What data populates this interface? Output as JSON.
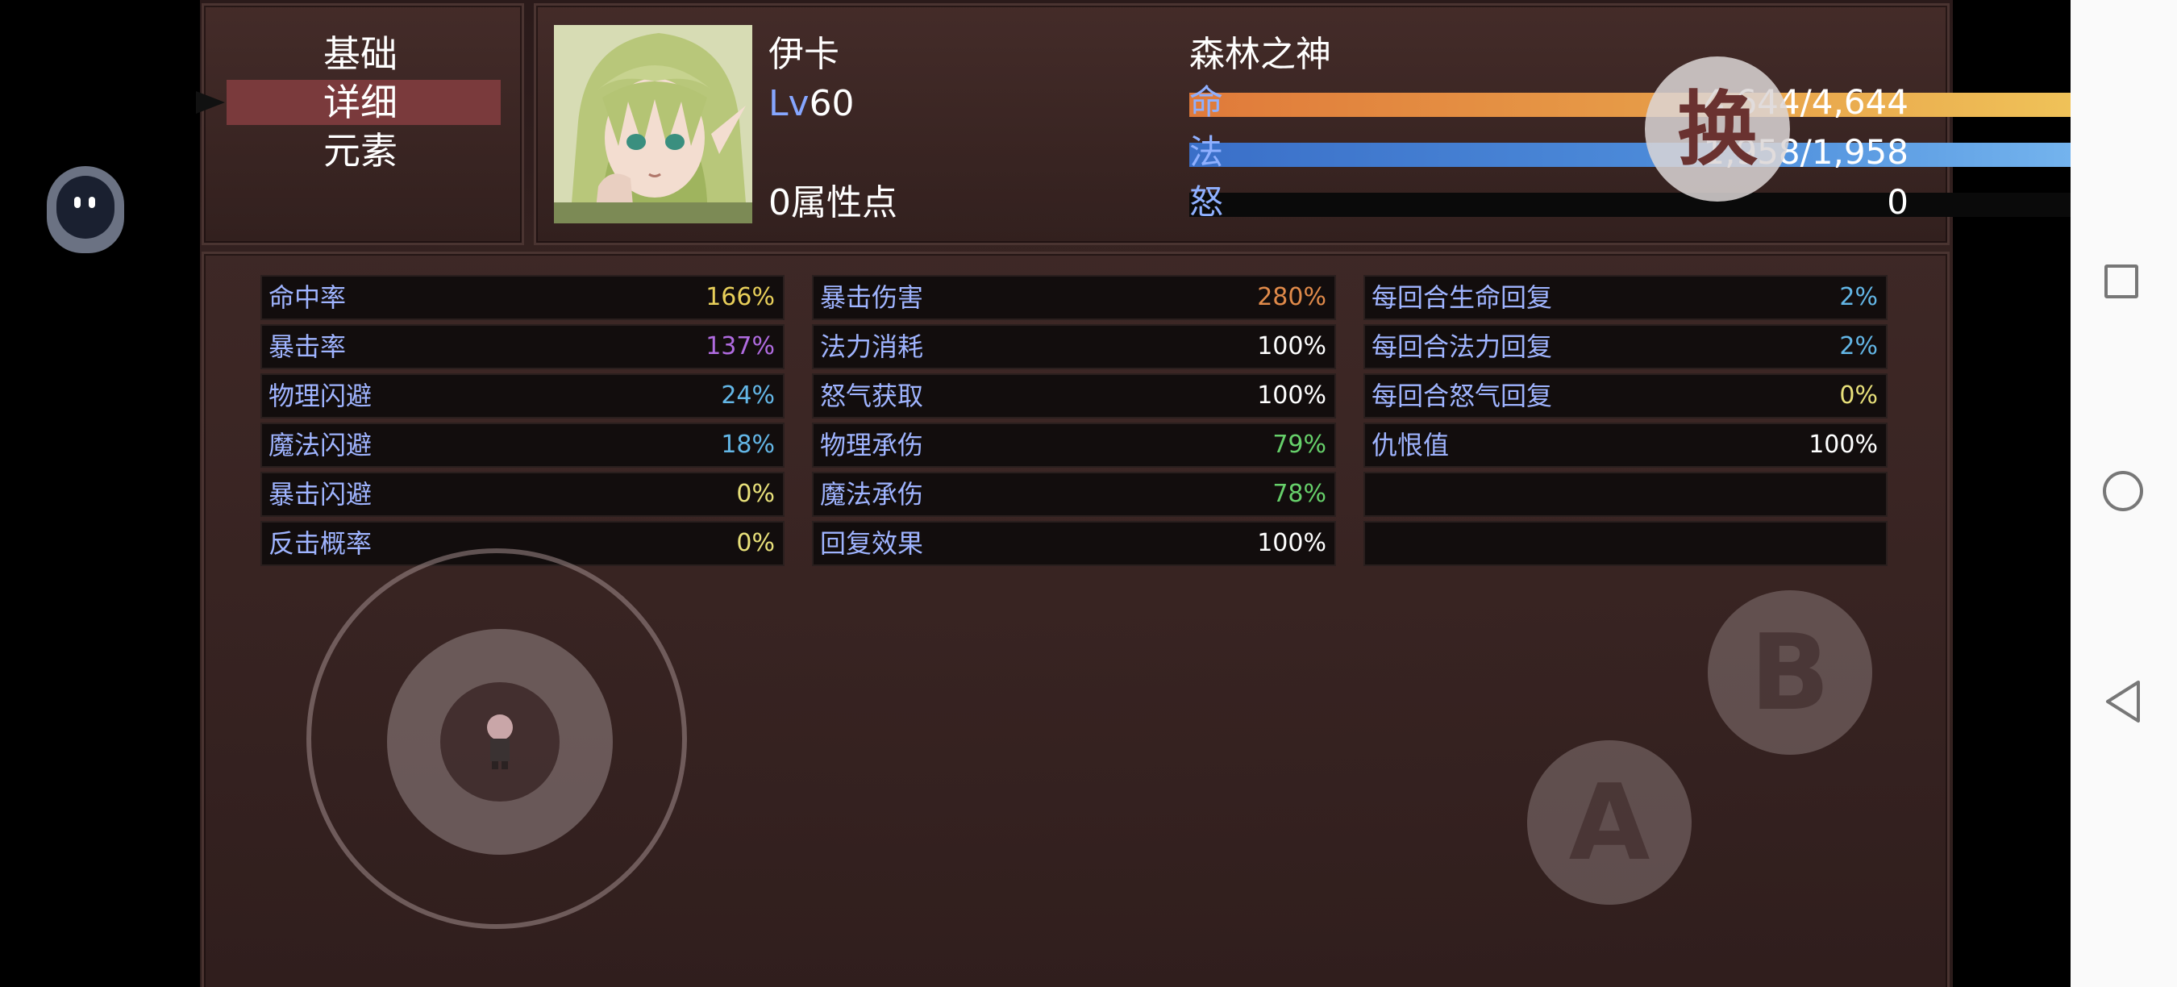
{
  "menu": {
    "items": [
      {
        "label": "基础"
      },
      {
        "label": "详细"
      },
      {
        "label": "元素"
      }
    ],
    "selected": "详细"
  },
  "character": {
    "name": "伊卡",
    "title": "森林之神",
    "level_prefix": "Lv",
    "level": "60",
    "attribute_points": "0属性点",
    "hp": {
      "label": "命",
      "value": "4,644/4,644",
      "fraction": 1.0,
      "color": "#e8a24a"
    },
    "mp": {
      "label": "法",
      "value": "1,958/1,958",
      "fraction": 1.0,
      "color": "#4f8fdc"
    },
    "rage": {
      "label": "怒",
      "value": "0",
      "fraction": 0.0,
      "color": "#d04040"
    }
  },
  "change_button": {
    "label": "换"
  },
  "stats": {
    "col1": [
      {
        "name": "命中率",
        "value": "166%",
        "color": "#e8cf5a"
      },
      {
        "name": "暴击率",
        "value": "137%",
        "color": "#b06be0"
      },
      {
        "name": "物理闪避",
        "value": "24%",
        "color": "#63b6e6"
      },
      {
        "name": "魔法闪避",
        "value": "18%",
        "color": "#63b6e6"
      },
      {
        "name": "暴击闪避",
        "value": "0%",
        "color": "#e8e07a"
      },
      {
        "name": "反击概率",
        "value": "0%",
        "color": "#e8e07a"
      }
    ],
    "col2": [
      {
        "name": "暴击伤害",
        "value": "280%",
        "color": "#e08a4a"
      },
      {
        "name": "法力消耗",
        "value": "100%",
        "color": "#ffffff"
      },
      {
        "name": "怒气获取",
        "value": "100%",
        "color": "#ffffff"
      },
      {
        "name": "物理承伤",
        "value": "79%",
        "color": "#66d06a"
      },
      {
        "name": "魔法承伤",
        "value": "78%",
        "color": "#66d06a"
      },
      {
        "name": "回复效果",
        "value": "100%",
        "color": "#ffffff"
      }
    ],
    "col3": [
      {
        "name": "每回合生命回复",
        "value": "2%",
        "color": "#63b6e6"
      },
      {
        "name": "每回合法力回复",
        "value": "2%",
        "color": "#63b6e6"
      },
      {
        "name": "每回合怒气回复",
        "value": "0%",
        "color": "#e8e07a"
      },
      {
        "name": "仇恨值",
        "value": "100%",
        "color": "#ffffff"
      },
      {
        "name": "",
        "value": "",
        "color": "#ffffff"
      },
      {
        "name": "",
        "value": "",
        "color": "#ffffff"
      }
    ]
  },
  "controls": {
    "button_a": "A",
    "button_b": "B"
  },
  "icons": {
    "menu_cursor": "arrow-right-icon",
    "assistant": "floating-assistant-icon",
    "nav_recent": "square-icon",
    "nav_home": "circle-icon",
    "nav_back": "triangle-back-icon"
  }
}
